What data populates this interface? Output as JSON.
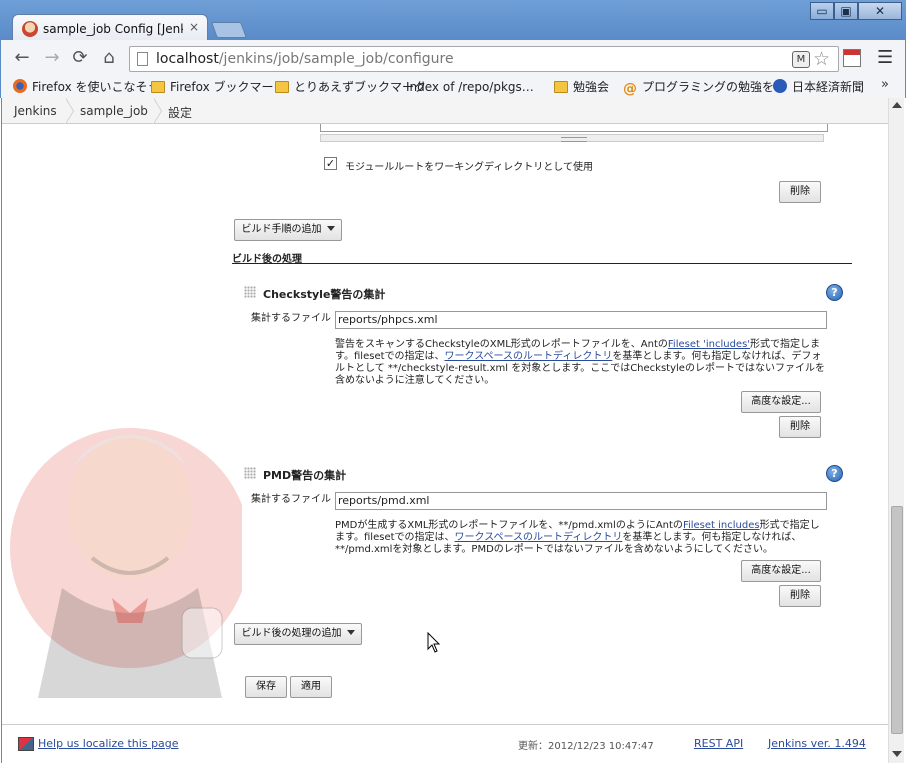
{
  "browser": {
    "tab_title": "sample_job Config [Jenkins",
    "tab_close": "×",
    "url_host": "localhost",
    "url_path": "/jenkins/job/sample_job/configure",
    "window_controls": {
      "minimize": "▭",
      "maximize": "▣",
      "close": "✕"
    },
    "nav": {
      "back": "←",
      "forward": "→",
      "reload": "⟳",
      "home": "⌂"
    },
    "bookmarks": [
      {
        "label": "Firefox を使いこなそう",
        "icon": "firefox-icon"
      },
      {
        "label": "Firefox ブックマーク",
        "icon": "folder-icon"
      },
      {
        "label": "とりあえずブックマーク",
        "icon": "folder-icon"
      },
      {
        "label": "Index of /repo/pkgs…",
        "icon": "page-icon"
      },
      {
        "label": "勉強会",
        "icon": "folder-icon"
      },
      {
        "label": "プログラミングの勉強を…",
        "icon": "at-icon"
      },
      {
        "label": "日本経済新聞",
        "icon": "paw-icon"
      }
    ],
    "bookmarks_more": "»"
  },
  "breadcrumbs": [
    "Jenkins",
    "sample_job",
    "設定"
  ],
  "module_root": {
    "checkbox_checked": true,
    "checkbox_mark": "✓",
    "label": "モジュールルートをワーキングディレクトリとして使用",
    "delete_label": "削除"
  },
  "add_build_step_label": "ビルド手順の追加",
  "post_build_header": "ビルド後の処理",
  "checkstyle": {
    "title": "Checkstyle警告の集計",
    "field_label": "集計するファイル",
    "field_value": "reports/phpcs.xml",
    "help": {
      "p1": "警告をスキャンするCheckstyleのXML形式のレポートファイルを、Antの",
      "link1": "Fileset 'includes'",
      "p2": "形式で指定します。filesetでの指定は、",
      "link2": "ワークスペースのルートディレクトリ",
      "p3": "を基準とします。何も指定しなければ、デフォルトとして **/checkstyle-result.xml を対象とします。ここではCheckstyleのレポートではないファイルを含めないように注意してください。"
    },
    "advanced_label": "高度な設定...",
    "delete_label": "削除"
  },
  "pmd": {
    "title": "PMD警告の集計",
    "field_label": "集計するファイル",
    "field_value": "reports/pmd.xml",
    "help": {
      "p1": "PMDが生成するXML形式のレポートファイルを、**/pmd.xmlのようにAntの",
      "link1": "Fileset includes",
      "p2": "形式で指定します。filesetでの指定は、",
      "link2": "ワークスペースのルートディレクトリ",
      "p3": "を基準とします。何も指定しなければ、**/pmd.xmlを対象とします。PMDのレポートではないファイルを含めないようにしてください。"
    },
    "advanced_label": "高度な設定...",
    "delete_label": "削除"
  },
  "add_post_build_label": "ビルド後の処理の追加",
  "save_label": "保存",
  "apply_label": "適用",
  "footer": {
    "localize_link": "Help us localize this page",
    "updated": "更新：2012/12/23 10:47:47",
    "rest_api": "REST API",
    "version": "Jenkins ver. 1.494"
  },
  "colors": {
    "title_bar": "#5a8bc9",
    "link": "#2a4b9b",
    "butler_red": "#d9443a"
  }
}
